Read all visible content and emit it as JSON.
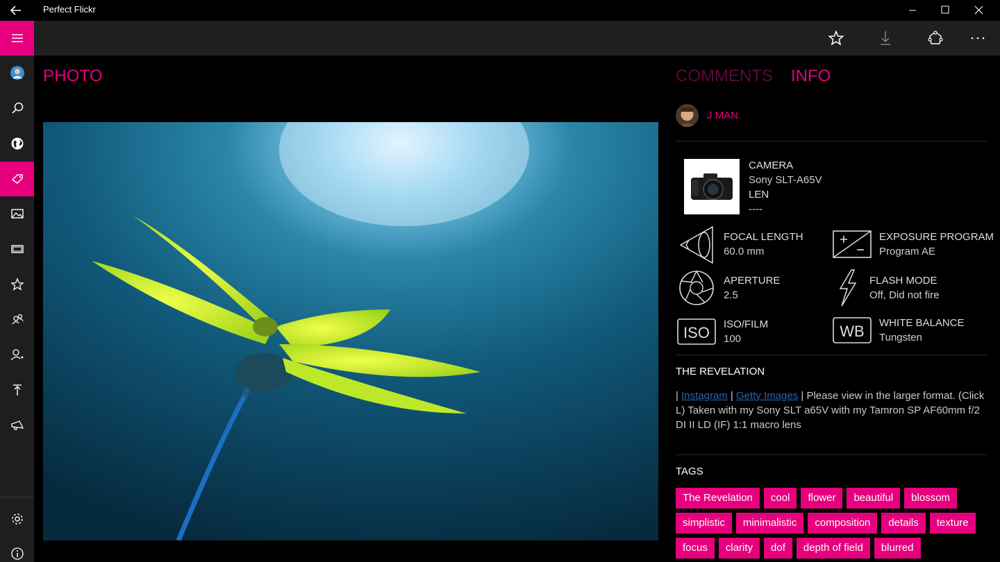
{
  "window": {
    "title": "Perfect Flickr"
  },
  "sidebar": {
    "items": [
      {
        "icon": "avatar-icon"
      },
      {
        "icon": "search-icon"
      },
      {
        "icon": "globe-icon"
      },
      {
        "icon": "tag-icon",
        "active": true
      },
      {
        "icon": "image-icon"
      },
      {
        "icon": "gallery-icon"
      },
      {
        "icon": "star-icon"
      },
      {
        "icon": "people-icon"
      },
      {
        "icon": "add-user-icon"
      },
      {
        "icon": "upload-icon"
      },
      {
        "icon": "megaphone-icon"
      }
    ],
    "bottom": [
      {
        "icon": "gear-icon"
      },
      {
        "icon": "info-icon"
      }
    ]
  },
  "appbar": {
    "actions": [
      "star-icon",
      "download-icon",
      "share-icon",
      "more-icon"
    ]
  },
  "photo": {
    "header": "PHOTO"
  },
  "info_panel": {
    "tabs": [
      {
        "label": "COMMENTS",
        "selected": false
      },
      {
        "label": "INFO",
        "selected": true
      }
    ],
    "owner": "J MAN.",
    "camera": {
      "header": "CAMERA",
      "model": "Sony SLT-A65V",
      "lens_label": "LEN",
      "lens_value": "----"
    },
    "specs": {
      "focal_length": {
        "label": "FOCAL LENGTH",
        "value": "60.0 mm"
      },
      "exposure_program": {
        "label": "EXPOSURE PROGRAM",
        "value": "Program AE"
      },
      "aperture": {
        "label": "APERTURE",
        "value": "2.5"
      },
      "flash_mode": {
        "label": "FLASH MODE",
        "value": "Off, Did not fire"
      },
      "iso": {
        "label": "ISO/FILM",
        "value": "100"
      },
      "white_balance": {
        "label": "WHITE BALANCE",
        "value": "Tungsten"
      }
    },
    "title": "THE REVELATION",
    "description": {
      "prefix": "| ",
      "link1": "Instagram",
      "middle": " |  ",
      "link2": "Getty Images",
      "rest": " | Please view in the larger format. (Click L) Taken with my Sony SLT a65V with my Tamron SP AF60mm f/2 DI II LD (IF) 1:1 macro lens"
    },
    "tags_header": "TAGS",
    "tags": [
      "The Revelation",
      "cool",
      "flower",
      "beautiful",
      "blossom",
      "simplistic",
      "minimalistic",
      "composition",
      "details",
      "texture",
      "focus",
      "clarity",
      "dof",
      "depth of field",
      "blurred"
    ]
  },
  "colors": {
    "accent": "#e6007e",
    "sidebar_bg": "#1e1e1e",
    "appbar_bg": "#1f1f1f",
    "link": "#2c63b8"
  }
}
